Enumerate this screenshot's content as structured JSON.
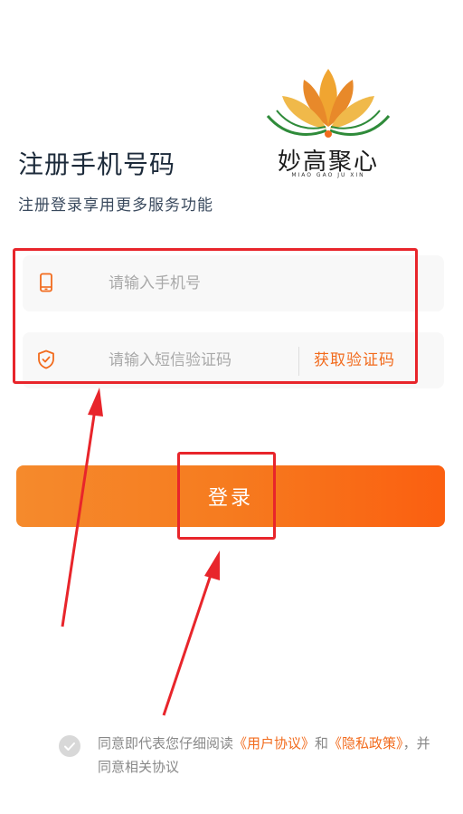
{
  "brand": {
    "name": "妙高聚心",
    "pinyin": "MIAO GAO JU XIN",
    "colors": {
      "petal": "#f0a531",
      "petal_dark": "#e8892a",
      "leaf": "#2f8b3a",
      "accent": "#f26b1d"
    }
  },
  "header": {
    "title": "注册手机号码",
    "subtitle": "注册登录享用更多服务功能"
  },
  "form": {
    "phone": {
      "icon": "phone-icon",
      "placeholder": "请输入手机号",
      "value": ""
    },
    "code": {
      "icon": "shield-check-icon",
      "placeholder": "请输入短信验证码",
      "value": ""
    },
    "get_code_label": "获取验证码",
    "login_label": "登录"
  },
  "agreement": {
    "prefix": "同意即代表您仔细阅读",
    "user_agreement": "《用户协议》",
    "and": "和",
    "privacy": "《隐私政策》",
    "suffix": "，并同意相关协议",
    "checked": false
  },
  "annotations": {
    "color": "#e8252b"
  }
}
